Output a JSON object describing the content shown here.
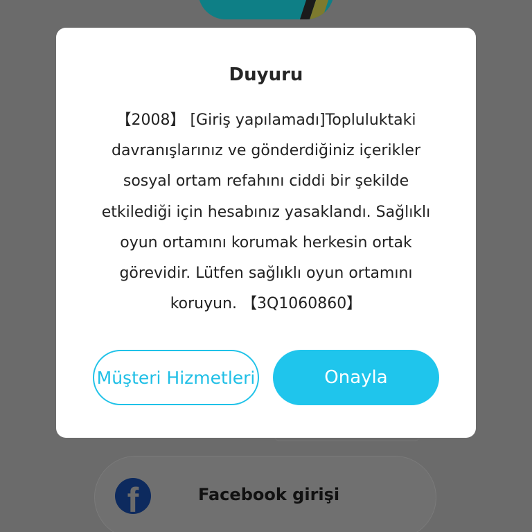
{
  "background": {
    "facebook_login_label": "Facebook girişi",
    "facebook_icon_glyph": "f"
  },
  "dialog": {
    "title": "Duyuru",
    "message": "【2008】 [Giriş yapılamadı]Topluluktaki davranışlarınız ve gönderdiğiniz içerikler sosyal ortam refahını ciddi bir şekilde etkilediği için hesabınız yasaklandı. Sağlıklı oyun ortamını korumak herkesin ortak görevidir. Lütfen sağlıklı oyun ortamını koruyun. 【3Q1060860】",
    "buttons": {
      "customer_service": "Müşteri Hizmetleri",
      "confirm": "Onayla"
    }
  },
  "colors": {
    "accent": "#1fc5ec",
    "overlay": "#6b6b6b",
    "dialog_bg": "#ffffff"
  },
  "icons": {
    "facebook": "facebook-icon"
  }
}
